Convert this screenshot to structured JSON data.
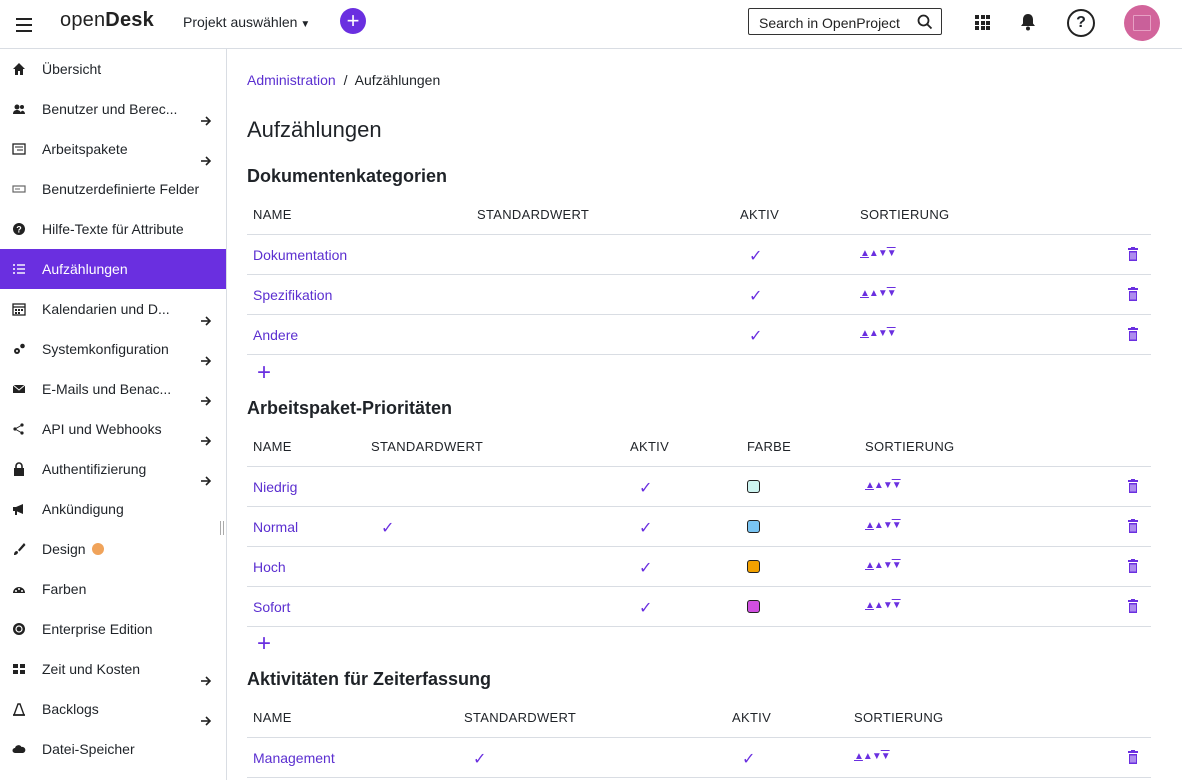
{
  "header": {
    "logo_text_1": "open",
    "logo_text_2": "Desk",
    "project_select": "Projekt auswählen",
    "search_placeholder": "Search in OpenProject"
  },
  "sidebar": {
    "items": [
      {
        "label": "Übersicht",
        "icon": "home-icon",
        "arrow": false
      },
      {
        "label": "Benutzer und Berec...",
        "icon": "users-icon",
        "arrow": true
      },
      {
        "label": "Arbeitspakete",
        "icon": "work-packages-icon",
        "arrow": true
      },
      {
        "label": "Benutzerdefinierte Felder",
        "icon": "custom-fields-icon",
        "arrow": false
      },
      {
        "label": "Hilfe-Texte für Attribute",
        "icon": "help-icon",
        "arrow": false
      },
      {
        "label": "Aufzählungen",
        "icon": "enumerations-icon",
        "arrow": false,
        "active": true
      },
      {
        "label": "Kalendarien und D...",
        "icon": "calendar-icon",
        "arrow": true
      },
      {
        "label": "Systemkonfiguration",
        "icon": "gears-icon",
        "arrow": true
      },
      {
        "label": "E-Mails und Benac...",
        "icon": "mail-icon",
        "arrow": true
      },
      {
        "label": "API und Webhooks",
        "icon": "api-icon",
        "arrow": true
      },
      {
        "label": "Authentifizierung",
        "icon": "lock-icon",
        "arrow": true
      },
      {
        "label": "Ankündigung",
        "icon": "megaphone-icon",
        "arrow": false
      },
      {
        "label": "Design",
        "icon": "brush-icon",
        "arrow": false,
        "badge": true
      },
      {
        "label": "Farben",
        "icon": "palette-icon",
        "arrow": false
      },
      {
        "label": "Enterprise Edition",
        "icon": "enterprise-icon",
        "arrow": false
      },
      {
        "label": "Zeit und Kosten",
        "icon": "time-icon",
        "arrow": true
      },
      {
        "label": "Backlogs",
        "icon": "backlogs-icon",
        "arrow": true
      },
      {
        "label": "Datei-Speicher",
        "icon": "cloud-icon",
        "arrow": false
      }
    ]
  },
  "breadcrumb": {
    "parent": "Administration",
    "separator": "/",
    "current": "Aufzählungen"
  },
  "page_title": "Aufzählungen",
  "sort_glyphs": {
    "top": "▲",
    "up": "▲",
    "down": "▼",
    "bottom": "▼"
  },
  "sections": {
    "doc": {
      "title": "Dokumentenkategorien",
      "columns": [
        "NAME",
        "STANDARDWERT",
        "AKTIV",
        "SORTIERUNG"
      ],
      "rows": [
        {
          "name": "Dokumentation",
          "default": false,
          "active": true
        },
        {
          "name": "Spezifikation",
          "default": false,
          "active": true
        },
        {
          "name": "Andere",
          "default": false,
          "active": true
        }
      ],
      "add_label": "+"
    },
    "prio": {
      "title": "Arbeitspaket-Prioritäten",
      "columns": [
        "NAME",
        "STANDARDWERT",
        "AKTIV",
        "FARBE",
        "SORTIERUNG"
      ],
      "rows": [
        {
          "name": "Niedrig",
          "default": false,
          "active": true,
          "color": "#cdf4f0"
        },
        {
          "name": "Normal",
          "default": true,
          "active": true,
          "color": "#79c4f2"
        },
        {
          "name": "Hoch",
          "default": false,
          "active": true,
          "color": "#f2a100"
        },
        {
          "name": "Sofort",
          "default": false,
          "active": true,
          "color": "#d04fe0"
        }
      ],
      "add_label": "+"
    },
    "time": {
      "title": "Aktivitäten für Zeiterfassung",
      "columns": [
        "NAME",
        "STANDARDWERT",
        "AKTIV",
        "SORTIERUNG"
      ],
      "rows": [
        {
          "name": "Management",
          "default": true,
          "active": true
        }
      ]
    }
  },
  "check_glyph": "✓",
  "accent_color": "#6a2fe0"
}
